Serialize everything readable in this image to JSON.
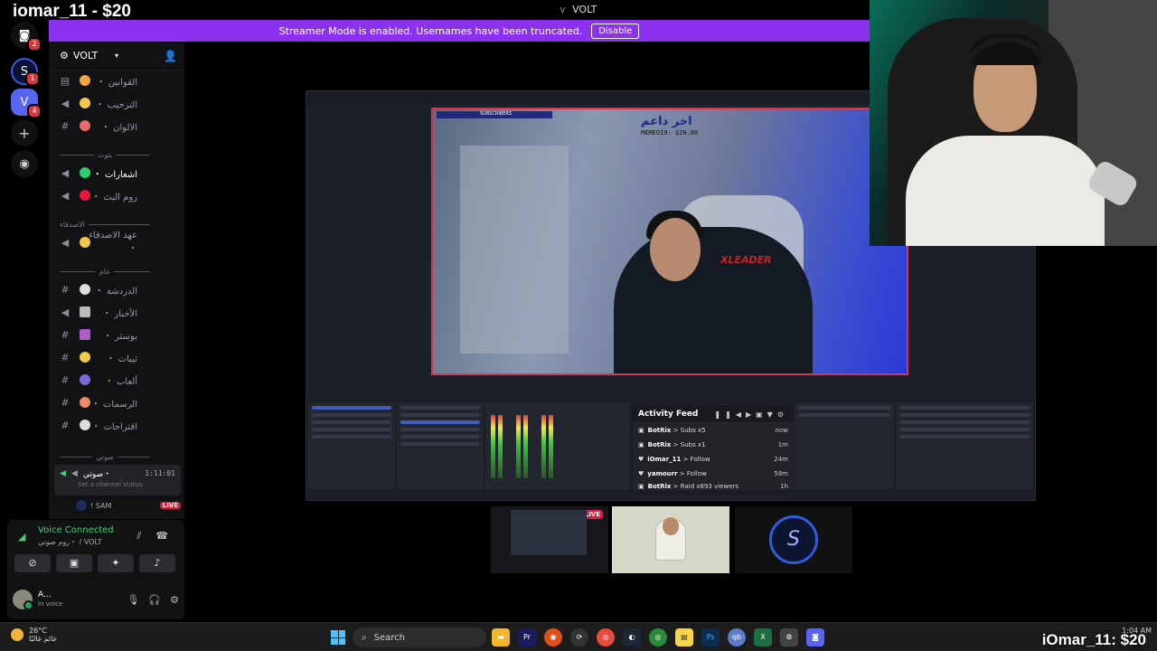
{
  "overlay": {
    "top_text": "iomar_11 - $20",
    "bottom_text": "iOmar_11: $20"
  },
  "window": {
    "title": "VOLT"
  },
  "streamer_mode": {
    "message": "Streamer Mode is enabled. Usernames have been truncated.",
    "button": "Disable"
  },
  "rail": {
    "home_badge": "2",
    "server1_badge": "1",
    "server_volt_initial": "V",
    "server_volt_badge": "4"
  },
  "guild": {
    "name": "VOLT"
  },
  "channels": [
    {
      "label": "القوانين ・",
      "icon": "rules-icon"
    },
    {
      "label": "الترحيب ・",
      "icon": "megaphone-icon"
    },
    {
      "label": "الالوان ・",
      "icon": "hash-icon"
    },
    {
      "label": "اشعارات ・",
      "icon": "megaphone-icon"
    },
    {
      "label": "روم البث ・",
      "icon": "speaker-icon"
    },
    {
      "label": "عهد الاصدقاء ・",
      "icon": "speaker-icon"
    },
    {
      "label": "الدردشة ・",
      "icon": "hash-icon"
    },
    {
      "label": "الأخبار ・",
      "icon": "megaphone-icon"
    },
    {
      "label": "بوستر ・",
      "icon": "hash-icon"
    },
    {
      "label": "ثيبات ・",
      "icon": "hash-icon"
    },
    {
      "label": "ألعاب ・",
      "icon": "hash-icon"
    },
    {
      "label": "الرسمات ・",
      "icon": "hash-icon"
    },
    {
      "label": "اقتراحات ・",
      "icon": "hash-icon"
    }
  ],
  "categories": [
    "بثوث",
    "الاصدقاء",
    "عام",
    "صوتي"
  ],
  "voice_channel": {
    "name": "صوتي・",
    "time": "1:11:01",
    "status": "Set a channel status"
  },
  "member": {
    "name": "! SAM",
    "live": "LIVE"
  },
  "voice_panel": {
    "title": "Voice Connected",
    "subtitle": "روم صوتي・ / VOLT"
  },
  "user": {
    "name": "A...",
    "status": "In voice"
  },
  "stream": {
    "banner": "SUBSCRIBERS",
    "donor_title": "اخر داعم",
    "donor_value": "MEMEOI9: $20.00",
    "brand": "XLEADER"
  },
  "activity_feed": {
    "title": "Activity Feed",
    "rows": [
      {
        "user": "BotRix",
        "action": "Subs x5",
        "time": "now"
      },
      {
        "user": "BotRix",
        "action": "Subs x1",
        "time": "1m"
      },
      {
        "user": "iOmar_11",
        "action": "Follow",
        "time": "24m"
      },
      {
        "user": "yamourr",
        "action": "Follow",
        "time": "58m"
      },
      {
        "user": "BotRix",
        "action": "Raid x893 viewers",
        "time": "1h"
      }
    ]
  },
  "thumb_live": "LIVE",
  "taskbar": {
    "temp": "26°C",
    "weather": "غائم غالبًا",
    "search": "Search",
    "time": "1:04 AM"
  }
}
